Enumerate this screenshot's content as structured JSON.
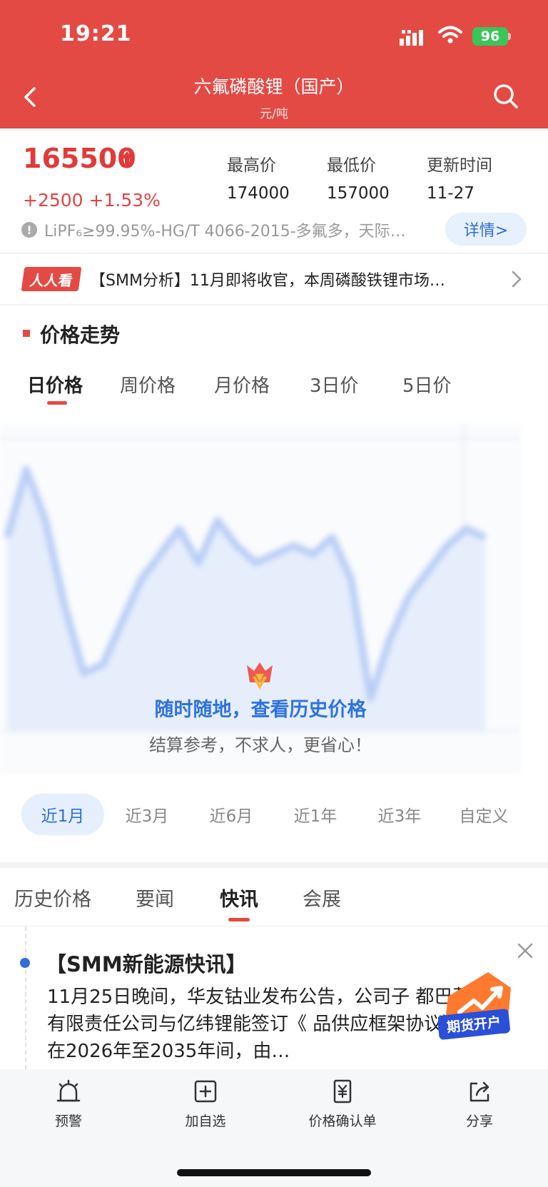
{
  "status_bar": {
    "time": "19:21",
    "battery": "96"
  },
  "header": {
    "title": "六氟磷酸锂（国产）",
    "unit": "元/吨"
  },
  "price": {
    "current": "165500",
    "change": "+2500 +1.53%",
    "stats": [
      {
        "label": "最高价",
        "value": "174000"
      },
      {
        "label": "最低价",
        "value": "157000"
      },
      {
        "label": "更新时间",
        "value": "11-27"
      }
    ],
    "spec": "LiPF₆≥99.95%-HG/T 4066-2015-多氟多，天际…",
    "detail_button": "详情>"
  },
  "news_banner": {
    "badge": "人人看",
    "text": "【SMM分析】11月即将收官，本周磷酸铁锂市场…"
  },
  "trend": {
    "section_title": "价格走势",
    "period_tabs": [
      "日价格",
      "周价格",
      "月价格",
      "3日价",
      "5日价"
    ],
    "promo_title": "随时随地，查看历史价格",
    "promo_subtitle": "结算参考，不求人，更省心！",
    "range_buttons": [
      "近1月",
      "近3月",
      "近6月",
      "近1年",
      "近3年",
      "自定义"
    ]
  },
  "chart_data": {
    "type": "area",
    "series": [
      {
        "values": [
          162,
          170,
          164,
          154,
          146,
          147,
          152,
          157,
          160,
          163,
          159,
          164,
          161,
          159,
          160,
          161,
          160,
          162,
          157,
          143,
          150,
          155,
          158,
          161,
          163,
          162
        ]
      }
    ]
  },
  "sub_tabs": [
    "历史价格",
    "要闻",
    "快讯",
    "会展"
  ],
  "flash": {
    "title": "【SMM新能源快讯】",
    "body": "11月25日晚间，华友钴业发布公告，公司子 都巴莫科技有限责任公司与亿纬锂能签订《 品供应框架协议》，约定在2026年至2035年间，由…",
    "futures_badge": "期货开户"
  },
  "bottom_bar": [
    "预警",
    "加自选",
    "价格确认单",
    "分享"
  ],
  "colors": {
    "brand_red": "#e34a44",
    "accent_blue": "#2f6fd6"
  }
}
